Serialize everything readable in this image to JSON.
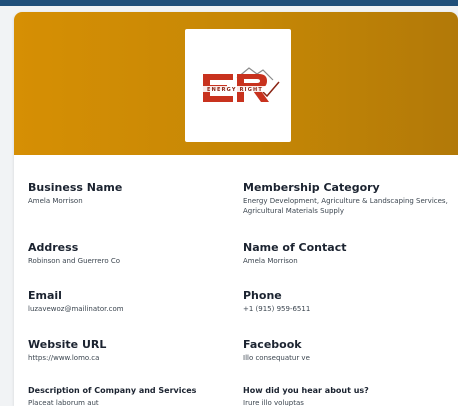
{
  "logo": {
    "letters": "ER",
    "tagline": "ENERGY RIGHT",
    "colors": {
      "red": "#c8321e",
      "dark": "#8a2414"
    }
  },
  "banner": {
    "color_start": "#d68f04",
    "color_end": "#b27908"
  },
  "fields": [
    {
      "label": "Business Name",
      "value": "Amela Morrison"
    },
    {
      "label": "Membership Category",
      "value": "Energy Development, Agriculture & Landscaping Services, Agricultural Materials Supply"
    },
    {
      "label": "Address",
      "value": "Robinson and Guerrero Co"
    },
    {
      "label": "Name of Contact",
      "value": "Amela Morrison"
    },
    {
      "label": "Email",
      "value": "luzavewoz@mailinator.com"
    },
    {
      "label": "Phone",
      "value": "+1 (915) 959-6511"
    },
    {
      "label": "Website URL",
      "value": "https://www.lomo.ca"
    },
    {
      "label": "Facebook",
      "value": "Illo consequatur ve"
    },
    {
      "label": "Description of Company and Services",
      "value": "Placeat laborum aut"
    },
    {
      "label": "How did you hear about us?",
      "value": "Irure illo voluptas"
    }
  ]
}
